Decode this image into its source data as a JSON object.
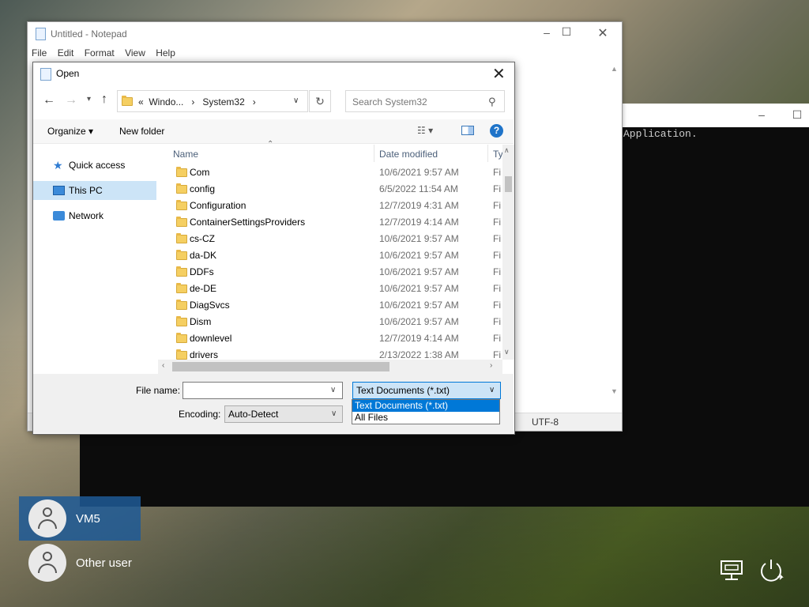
{
  "console": {
    "text": "Application."
  },
  "notepad": {
    "title": "Untitled - Notepad",
    "menu": [
      "File",
      "Edit",
      "Format",
      "View",
      "Help"
    ],
    "status_encoding": "UTF-8"
  },
  "dialog": {
    "title": "Open",
    "address": {
      "segments": [
        "«",
        "Windo...",
        "›",
        "System32",
        "›"
      ]
    },
    "search_placeholder": "Search System32",
    "toolbar": {
      "organize": "Organize ▾",
      "new_folder": "New folder"
    },
    "nav": [
      {
        "label": "Quick access",
        "icon": "star-icon"
      },
      {
        "label": "This PC",
        "icon": "computer-icon",
        "selected": true
      },
      {
        "label": "Network",
        "icon": "network-icon"
      }
    ],
    "columns": {
      "name": "Name",
      "date": "Date modified",
      "type": "Ty"
    },
    "files": [
      {
        "name": "Com",
        "date": "10/6/2021 9:57 AM",
        "type": "Fi"
      },
      {
        "name": "config",
        "date": "6/5/2022 11:54 AM",
        "type": "Fi"
      },
      {
        "name": "Configuration",
        "date": "12/7/2019 4:31 AM",
        "type": "Fi"
      },
      {
        "name": "ContainerSettingsProviders",
        "date": "12/7/2019 4:14 AM",
        "type": "Fi"
      },
      {
        "name": "cs-CZ",
        "date": "10/6/2021 9:57 AM",
        "type": "Fi"
      },
      {
        "name": "da-DK",
        "date": "10/6/2021 9:57 AM",
        "type": "Fi"
      },
      {
        "name": "DDFs",
        "date": "10/6/2021 9:57 AM",
        "type": "Fi"
      },
      {
        "name": "de-DE",
        "date": "10/6/2021 9:57 AM",
        "type": "Fi"
      },
      {
        "name": "DiagSvcs",
        "date": "10/6/2021 9:57 AM",
        "type": "Fi"
      },
      {
        "name": "Dism",
        "date": "10/6/2021 9:57 AM",
        "type": "Fi"
      },
      {
        "name": "downlevel",
        "date": "12/7/2019 4:14 AM",
        "type": "Fi"
      },
      {
        "name": "drivers",
        "date": "2/13/2022 1:38 AM",
        "type": "Fi"
      }
    ],
    "filename_label": "File name:",
    "filename_value": "",
    "filetype_selected": "Text Documents (*.txt)",
    "filetype_options": [
      "Text Documents (*.txt)",
      "All Files"
    ],
    "encoding_label": "Encoding:",
    "encoding_value": "Auto-Detect"
  },
  "users": [
    {
      "name": "VM5",
      "selected": true
    },
    {
      "name": "Other user",
      "selected": false
    }
  ],
  "accent_color": "#0078d7",
  "selection_color": "#cce4f7"
}
